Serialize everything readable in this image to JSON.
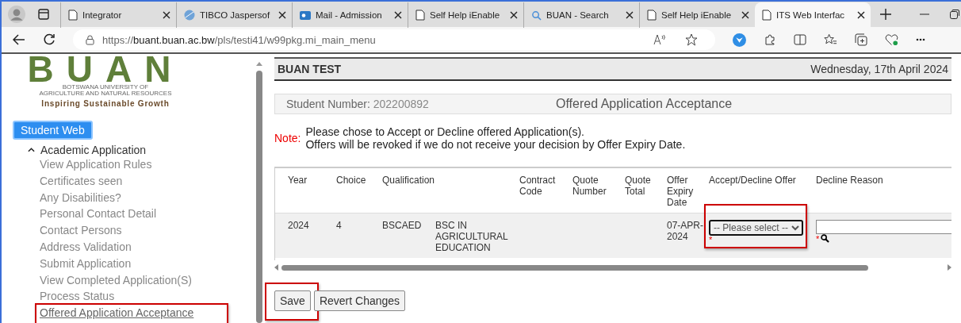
{
  "browser": {
    "tabs": [
      {
        "title": "Integrator",
        "kind": "page",
        "selected": false
      },
      {
        "title": "TIBCO Jaspersof",
        "kind": "globe",
        "selected": false
      },
      {
        "title": "Mail - Admission",
        "kind": "mail",
        "selected": false
      },
      {
        "title": "Self Help iEnable",
        "kind": "page",
        "selected": false
      },
      {
        "title": "BUAN - Search",
        "kind": "search",
        "selected": false
      },
      {
        "title": "Self Help iEnable",
        "kind": "page",
        "selected": false
      },
      {
        "title": "ITS Web Interfac",
        "kind": "page",
        "selected": true
      }
    ],
    "url_scheme": "https://",
    "url_host": "buant.buan.ac.bw",
    "url_path": "/pls/testi41/w99pkg.mi_main_menu"
  },
  "logo": {
    "wordmark": "BUAN",
    "line_1": "BOTSWANA UNIVERSITY OF",
    "line_2": "AGRICULTURE AND NATURAL RESOURCES",
    "tagline": "Inspiring Sustainable Growth"
  },
  "sidebar": {
    "root": "Student Web",
    "section": {
      "label": "Academic Application",
      "expanded": true,
      "children": [
        {
          "label": "View Application Rules",
          "selected": false,
          "annotated": false
        },
        {
          "label": "Certificates seen",
          "selected": false,
          "annotated": false
        },
        {
          "label": "Any Disabilities?",
          "selected": false,
          "annotated": false
        },
        {
          "label": "Personal Contact Detail",
          "selected": false,
          "annotated": false
        },
        {
          "label": "Contact Persons",
          "selected": false,
          "annotated": false
        },
        {
          "label": "Address Validation",
          "selected": false,
          "annotated": false
        },
        {
          "label": "Submit Application",
          "selected": false,
          "annotated": false
        },
        {
          "label": "View Completed Application(S)",
          "selected": false,
          "annotated": false
        },
        {
          "label": "Process Status",
          "selected": false,
          "annotated": false
        },
        {
          "label": "Offered Application Acceptance",
          "selected": true,
          "annotated": true
        }
      ]
    }
  },
  "header": {
    "site": "BUAN TEST",
    "date": "Wednesday, 17th April 2024"
  },
  "student_bar": {
    "label": "Student Number:",
    "value": "202200892",
    "title": "Offered Application Acceptance"
  },
  "note": {
    "label": "Note:",
    "lines": [
      "Please chose to Accept or Decline offered Application(s).",
      "Offers will be revoked if we do not receive your decision by Offer Expiry Date."
    ]
  },
  "table": {
    "columns": [
      "Year",
      "Choice",
      "Qualification",
      "",
      "Contract Code",
      "Quote Number",
      "Quote Total",
      "Offer Expiry Date",
      "Accept/Decline Offer",
      "Decline Reason"
    ],
    "rows": [
      {
        "year": "2024",
        "choice": "4",
        "code": "BSCAED",
        "qualification": "BSC IN AGRICULTURAL EDUCATION",
        "expiry": "07-APR-2024",
        "decision_placeholder": "-- Please select --",
        "decision_required": "*",
        "decision_annotated": true,
        "reason_required": "*"
      }
    ]
  },
  "buttons": [
    {
      "label": "Save",
      "annotated": true
    },
    {
      "label": "Revert Changes",
      "annotated": false
    }
  ]
}
